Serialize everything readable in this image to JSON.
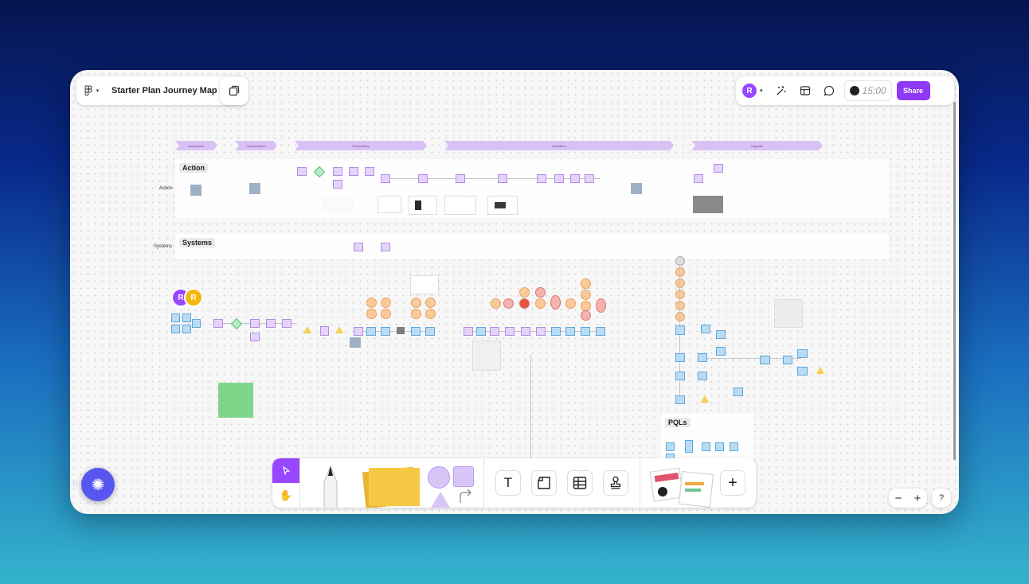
{
  "file": {
    "title": "Starter Plan Journey Map",
    "menu_icon": "figma-logo-icon",
    "pages_icon": "pages-icon"
  },
  "header": {
    "user_initial": "R",
    "timer": "15:00",
    "share_label": "Share",
    "icons": [
      "actions-icon",
      "layout-icon",
      "comment-icon"
    ]
  },
  "canvas": {
    "phases": [
      "Awareness",
      "Consideration",
      "Onboarding",
      "Activation",
      "Upgrade"
    ],
    "lanes": {
      "action_tag": "Action",
      "action_side": "Action",
      "systems_tag": "Systems",
      "systems_side": "Systems",
      "pqls_tag": "PQLs"
    },
    "collaborators": [
      "R",
      "R"
    ],
    "collab_colors": [
      "#9747ff",
      "#f5b70f"
    ]
  },
  "toolbar": {
    "tools": [
      "move-tool",
      "hand-tool",
      "pencil",
      "sticky-note",
      "shapes",
      "connector",
      "text",
      "section",
      "table",
      "stamp",
      "widgets",
      "add"
    ],
    "text_glyph": "T",
    "add_glyph": "+"
  },
  "zoom": {
    "out": "−",
    "in": "+"
  },
  "help_label": "?",
  "colors": {
    "accent": "#9747ff",
    "share": "#8f38f5",
    "sticky_yellow": "#f6c944",
    "sticky_green": "#7ed68a",
    "fab": "#5856f0"
  }
}
